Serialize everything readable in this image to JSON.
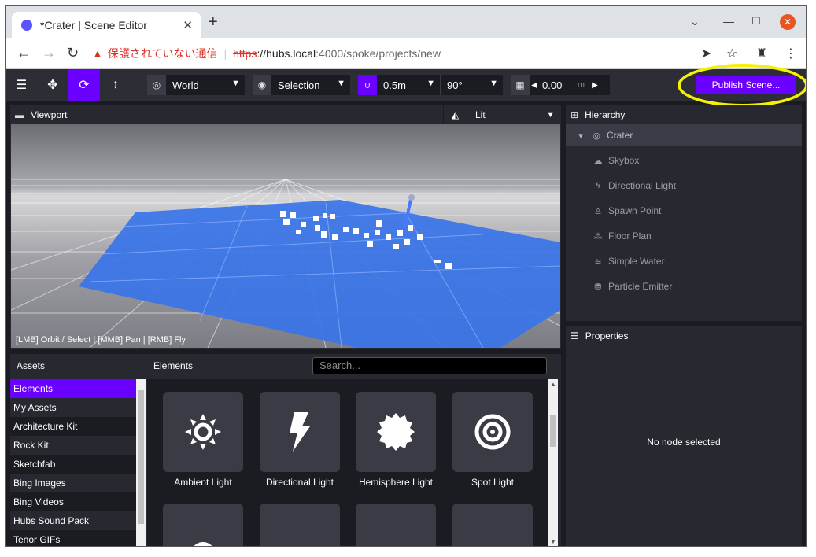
{
  "browser": {
    "tab_title": "*Crater | Scene Editor",
    "warning_text": "保護されていない通信",
    "url_scheme": "https",
    "url_host": "://hubs.local",
    "url_path": ":4000/spoke/projects/new"
  },
  "toolbar": {
    "transform_space": "World",
    "pivot": "Selection",
    "snap_translate": "0.5m",
    "snap_rotate": "90°",
    "grid_height": "0.00",
    "grid_unit": "m",
    "publish_label": "Publish Scene..."
  },
  "viewport": {
    "title": "Viewport",
    "render_mode": "Lit",
    "hint": "[LMB] Orbit / Select | [MMB] Pan | [RMB] Fly"
  },
  "hierarchy": {
    "title": "Hierarchy",
    "root": "Crater",
    "items": [
      {
        "label": "Skybox",
        "icon": "cloud-icon"
      },
      {
        "label": "Directional Light",
        "icon": "bolt-icon"
      },
      {
        "label": "Spawn Point",
        "icon": "person-icon"
      },
      {
        "label": "Floor Plan",
        "icon": "shoe-prints-icon"
      },
      {
        "label": "Simple Water",
        "icon": "water-icon"
      },
      {
        "label": "Particle Emitter",
        "icon": "spray-can-icon"
      }
    ]
  },
  "properties": {
    "title": "Properties",
    "empty": "No node selected"
  },
  "assets": {
    "title": "Assets",
    "items": [
      "Elements",
      "My Assets",
      "Architecture Kit",
      "Rock Kit",
      "Sketchfab",
      "Bing Images",
      "Bing Videos",
      "Hubs Sound Pack",
      "Tenor GIFs"
    ]
  },
  "elements": {
    "title": "Elements",
    "search_placeholder": "Search...",
    "cards": [
      "Ambient Light",
      "Directional Light",
      "Hemisphere Light",
      "Spot Light"
    ]
  },
  "colors": {
    "accent": "#6a00ff",
    "panel": "#282930",
    "background": "#1b1c22",
    "highlight_ring": "#f5f005"
  }
}
